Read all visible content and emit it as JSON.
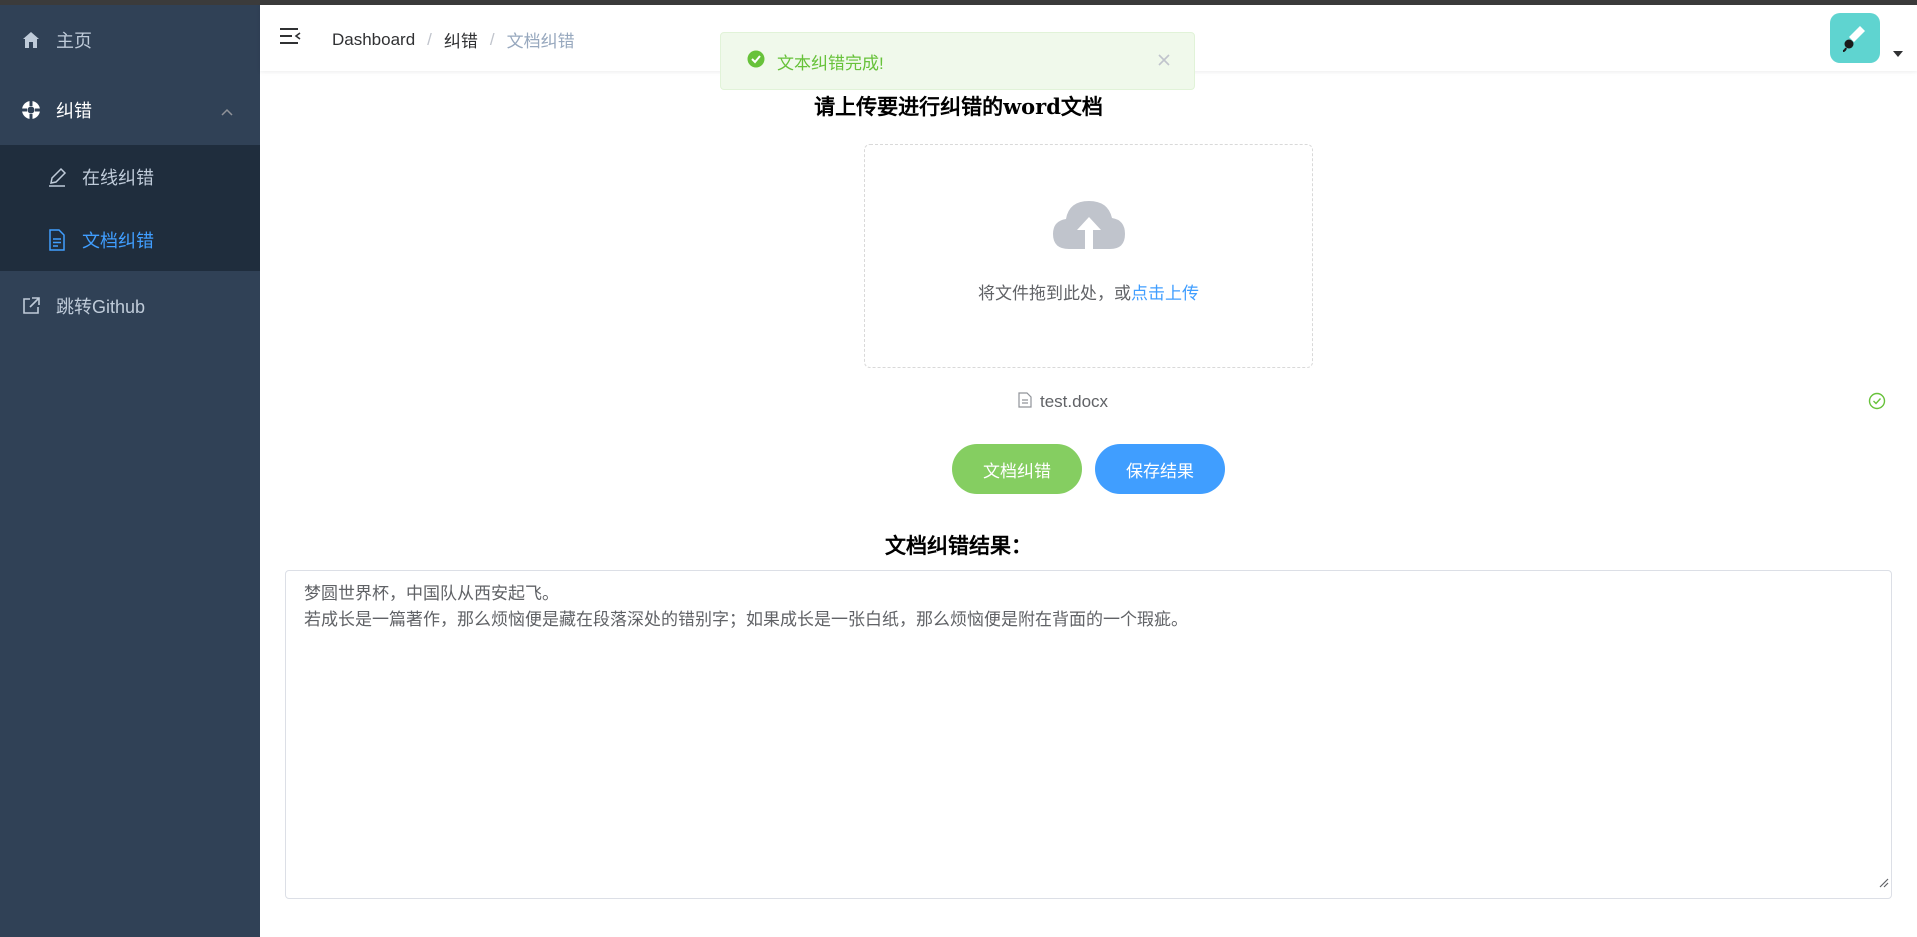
{
  "sidebar": {
    "items": [
      {
        "label": "主页",
        "icon": "home-icon"
      },
      {
        "label": "纠错",
        "icon": "lifebuoy-icon",
        "expanded": true,
        "children": [
          {
            "label": "在线纠错",
            "icon": "edit-icon"
          },
          {
            "label": "文档纠错",
            "icon": "document-icon",
            "active": true
          }
        ]
      },
      {
        "label": "跳转Github",
        "icon": "external-link-icon"
      }
    ]
  },
  "navbar": {
    "breadcrumb": [
      "Dashboard",
      "纠错",
      "文档纠错"
    ]
  },
  "message": {
    "type": "success",
    "text": "文本纠错完成!"
  },
  "upload": {
    "title": "请上传要进行纠错的word文档",
    "drop_text": "将文件拖到此处，或",
    "click_text": "点击上传",
    "file_name": "test.docx"
  },
  "buttons": {
    "correct_label": "文档纠错",
    "save_label": "保存结果"
  },
  "result": {
    "title": "文档纠错结果：",
    "lines": [
      "梦圆世界杯，中国队从西安起飞。",
      "若成长是一篇著作，那么烦恼便是藏在段落深处的错别字；如果成长是一张白纸，那么烦恼便是附在背面的一个瑕疵。"
    ]
  },
  "colors": {
    "sidebar_bg": "#304156",
    "submenu_bg": "#1f2d3d",
    "accent": "#409eff",
    "success": "#67c23a",
    "green_button": "#85ce61",
    "avatar_bg": "#5fd4d0"
  }
}
